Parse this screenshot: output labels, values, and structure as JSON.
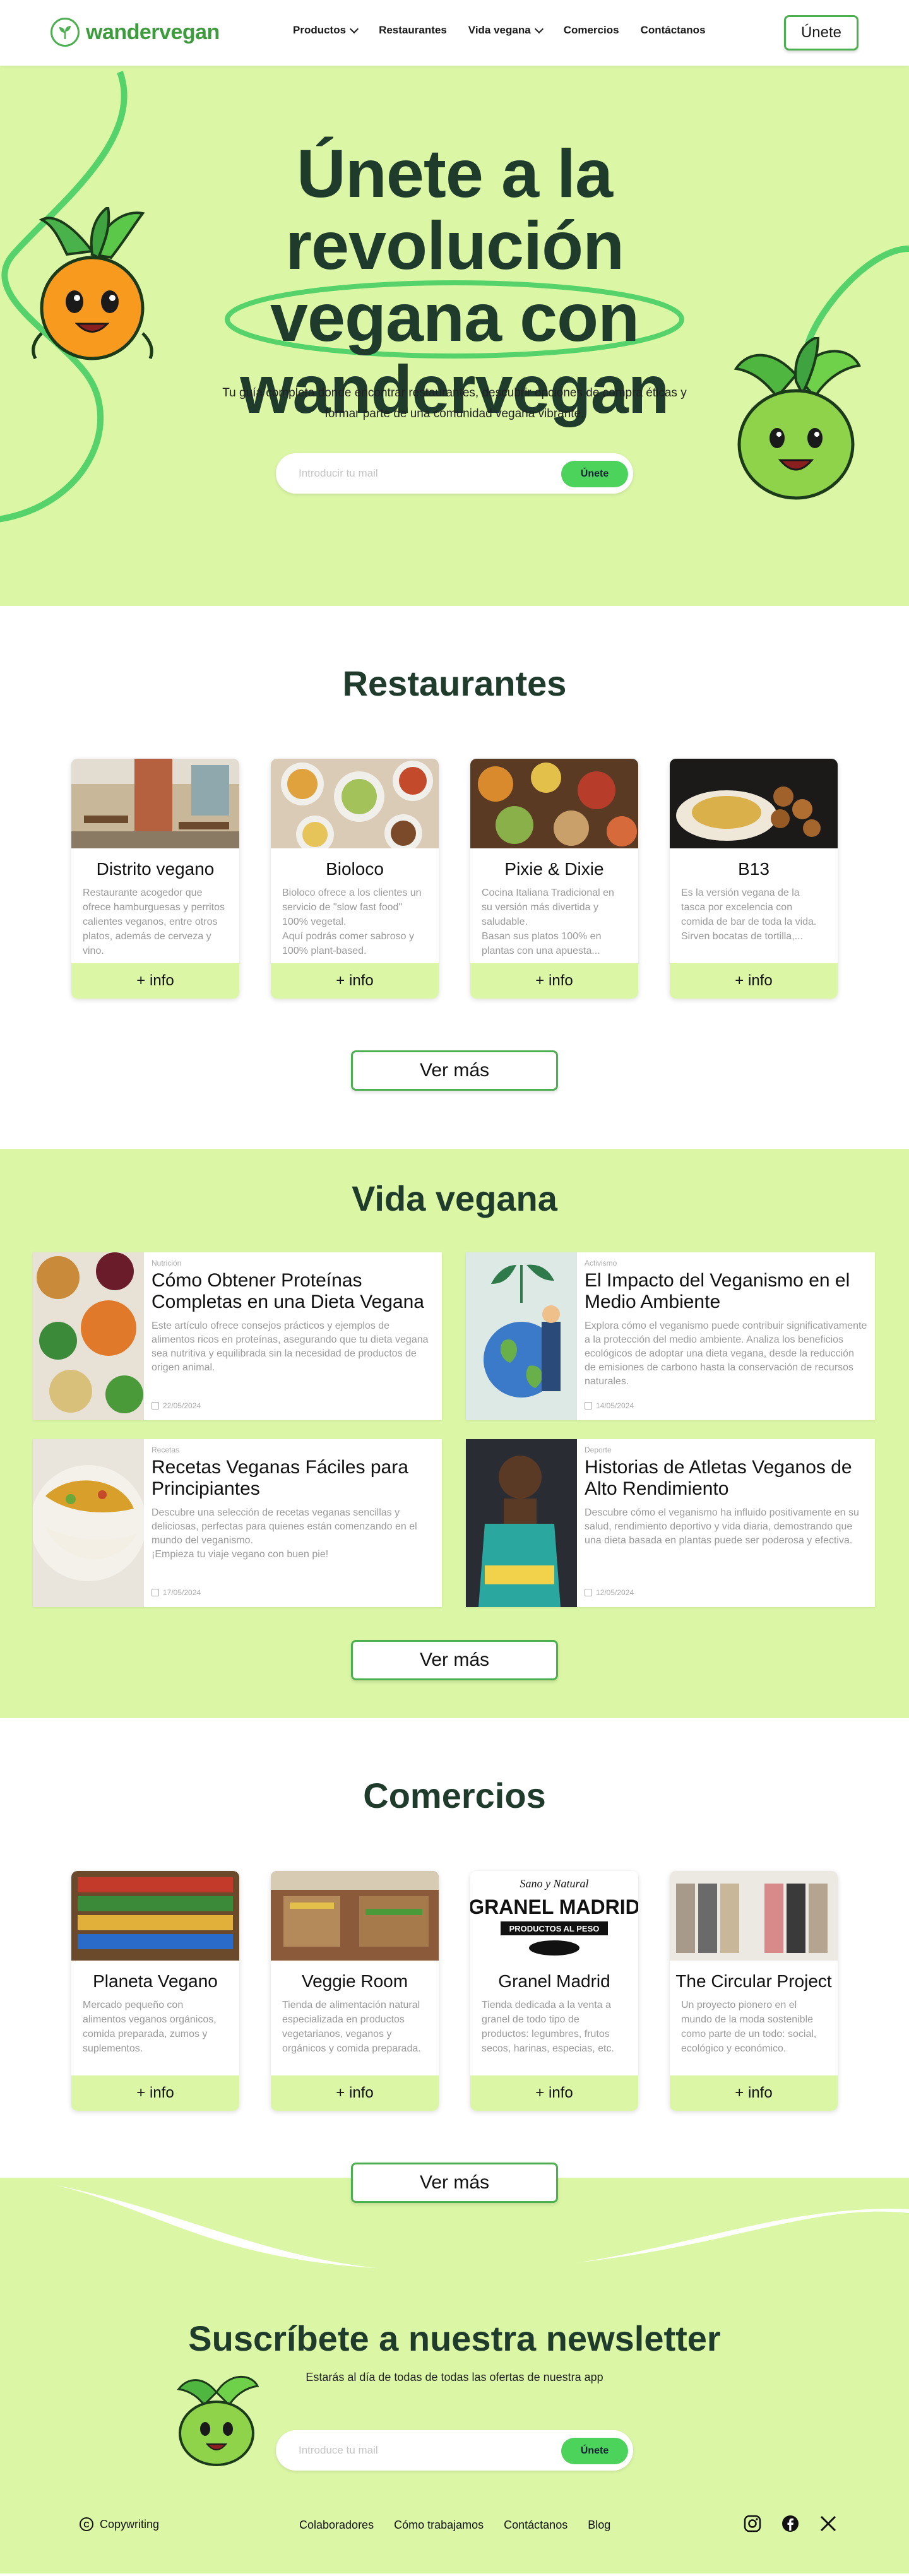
{
  "nav": {
    "logo_text": "wandervegan",
    "links": [
      {
        "label": "Productos",
        "has_dropdown": true
      },
      {
        "label": "Restaurantes",
        "has_dropdown": false
      },
      {
        "label": "Vida vegana",
        "has_dropdown": true
      },
      {
        "label": "Comercios",
        "has_dropdown": false
      },
      {
        "label": "Contáctanos",
        "has_dropdown": false
      }
    ],
    "join_label": "Únete"
  },
  "hero": {
    "title_line1": "Únete a la revolución",
    "title_line2": "vegana con",
    "title_brand": "wandervegan",
    "subtitle": "Tu guía completa donde encontrar restaurantes, descubrir opciones de compra éticas y formar parte de una comunidad vegana vibrante.",
    "email_placeholder": "Introducir tu mail",
    "submit_label": "Únete"
  },
  "restaurantes": {
    "title": "Restaurantes",
    "cards": [
      {
        "name": "Distrito vegano",
        "desc": "Restaurante acogedor que ofrece hamburguesas y perritos calientes veganos, entre otros platos, además de cerveza y vino.",
        "button": "+ info"
      },
      {
        "name": "Bioloco",
        "desc": "Bioloco ofrece a los clientes un servicio de \"slow fast food\" 100% vegetal.\nAquí podrás comer sabroso y 100% plant-based.",
        "button": "+ info"
      },
      {
        "name": "Pixie & Dixie",
        "desc": "Cocina Italiana Tradicional en su versión más divertida y saludable.\nBasan sus platos 100% en plantas con una apuesta...",
        "button": "+ info"
      },
      {
        "name": "B13",
        "desc": "Es la versión vegana de la tasca por excelencia con comida de bar de toda la vida.\nSirven bocatas de tortilla,...",
        "button": "+ info"
      }
    ],
    "more_label": "Ver más"
  },
  "vida": {
    "title": "Vida vegana",
    "articles": [
      {
        "category": "Nutrición",
        "title": "Cómo Obtener Proteínas Completas en una Dieta Vegana",
        "desc": "Este artículo ofrece consejos prácticos y ejemplos de alimentos ricos en proteínas, asegurando que tu dieta vegana sea nutritiva y equilibrada sin la necesidad de productos de origen animal.",
        "date": "22/05/2024"
      },
      {
        "category": "Activismo",
        "title": "El Impacto del Veganismo en el Medio Ambiente",
        "desc": "Explora cómo el veganismo puede contribuir significativamente a la protección del medio ambiente. Analiza los beneficios ecológicos de adoptar una dieta vegana, desde la reducción de emisiones de carbono hasta la conservación de recursos naturales.",
        "date": "14/05/2024"
      },
      {
        "category": "Recetas",
        "title": "Recetas Veganas Fáciles para Principiantes",
        "desc": "Descubre una selección de recetas veganas sencillas y deliciosas, perfectas para quienes están comenzando en el mundo del veganismo.\n¡Empieza tu viaje vegano con buen pie!",
        "date": "17/05/2024"
      },
      {
        "category": "Deporte",
        "title": "Historias de Atletas Veganos de Alto Rendimiento",
        "desc": "Descubre cómo el veganismo ha influido positivamente en su salud, rendimiento deportivo y vida diaria, demostrando que una dieta basada en plantas puede ser poderosa y efectiva.",
        "date": "12/05/2024"
      }
    ],
    "more_label": "Ver más"
  },
  "comercios": {
    "title": "Comercios",
    "cards": [
      {
        "name": "Planeta Vegano",
        "desc": "Mercado pequeño con alimentos veganos orgánicos, comida preparada, zumos y suplementos.",
        "button": "+ info"
      },
      {
        "name": "Veggie Room",
        "desc": "Tienda de alimentación natural especializada en productos vegetarianos, veganos y orgánicos y comida preparada.",
        "button": "+ info"
      },
      {
        "name": "Granel Madrid",
        "desc": "Tienda dedicada a la venta a granel de todo tipo de productos: legumbres, frutos secos, harinas, especias, etc.",
        "button": "+ info"
      },
      {
        "name": "The Circular Project",
        "desc": "Un proyecto pionero en el mundo de la moda sostenible como parte de un todo: social, ecológico y económico.",
        "button": "+ info"
      }
    ],
    "granel_logo": [
      "Sano y Natural",
      "GRANEL MADRID",
      "PRODUCTOS AL PESO"
    ],
    "more_label": "Ver más"
  },
  "newsletter": {
    "title": "Suscríbete a nuestra newsletter",
    "subtitle": "Estarás al día de todas de todas las ofertas de nuestra app",
    "email_placeholder": "Introduce tu mail",
    "submit_label": "Únete"
  },
  "footer": {
    "copyright": "Copywriting",
    "links": [
      "Colaboradores",
      "Cómo trabajamos",
      "Contáctanos",
      "Blog"
    ],
    "socials": [
      "instagram-icon",
      "facebook-icon",
      "x-icon"
    ]
  },
  "colors": {
    "accent_green": "#4caf50",
    "light_green_bg": "#dbf7a6",
    "pill_green": "#4cd35b",
    "dark_text": "#1f3b2c"
  }
}
